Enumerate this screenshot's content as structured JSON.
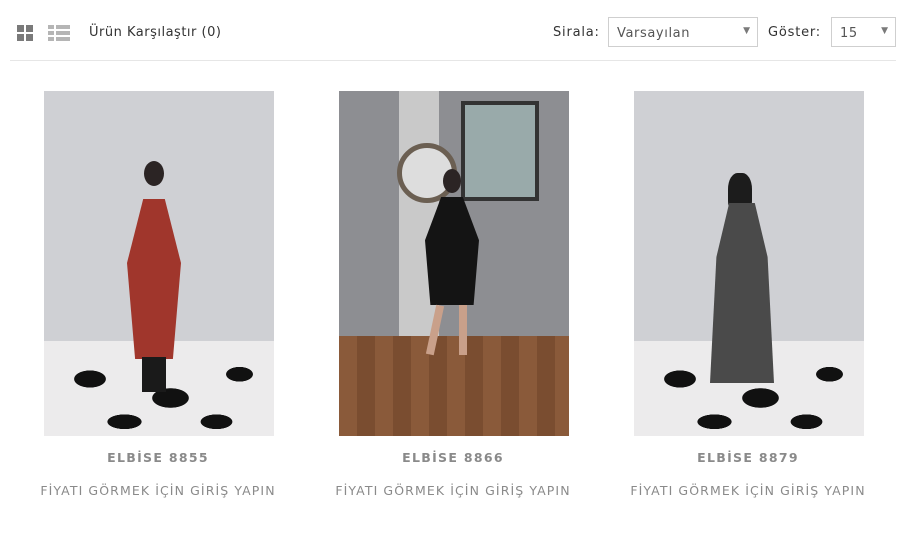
{
  "toolbar": {
    "grid_view_icon": "grid-icon",
    "list_view_icon": "list-icon",
    "compare_label": "Ürün Karşılaştır (0)",
    "sort_label": "Sirala:",
    "sort_value": "Varsayılan",
    "show_label": "Göster:",
    "show_value": "15"
  },
  "products": [
    {
      "name": "ELBİSE 8855",
      "price_text": "FİYATI GÖRMEK İÇİN GİRİŞ YAPIN",
      "dress_color": "#a0362c"
    },
    {
      "name": "ELBİSE 8866",
      "price_text": "FİYATI GÖRMEK İÇİN GİRİŞ YAPIN",
      "dress_color": "#141414"
    },
    {
      "name": "ELBİSE 8879",
      "price_text": "FİYATI GÖRMEK İÇİN GİRİŞ YAPIN",
      "dress_color": "#4a4a4a"
    }
  ]
}
